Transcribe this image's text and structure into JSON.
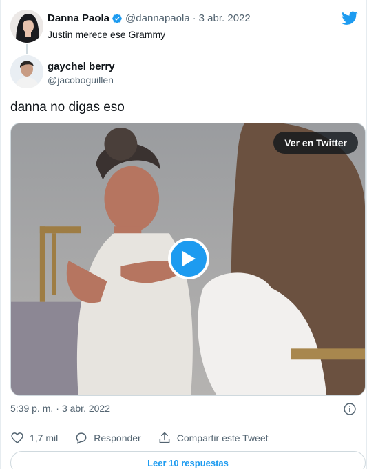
{
  "quoted_tweet": {
    "name": "Danna Paola",
    "handle": "@dannapaola",
    "separator": "·",
    "date": "3 abr. 2022",
    "text": "Justin merece ese Grammy"
  },
  "tweet": {
    "author_name": "gaychel berry",
    "author_handle": "@jacoboguillen",
    "text": "danna no digas eso"
  },
  "media": {
    "view_label": "Ver en Twitter",
    "play_icon": "play-icon"
  },
  "meta": {
    "time": "5:39 p. m.",
    "separator": "·",
    "date": "3 abr. 2022"
  },
  "actions": {
    "likes": "1,7 mil",
    "reply_label": "Responder",
    "share_label": "Compartir este Tweet"
  },
  "footer": {
    "read_replies": "Leer 10 respuestas"
  },
  "colors": {
    "accent": "#1d9bf0",
    "text": "#0f1419",
    "muted": "#536471",
    "border": "#cfd9de"
  }
}
